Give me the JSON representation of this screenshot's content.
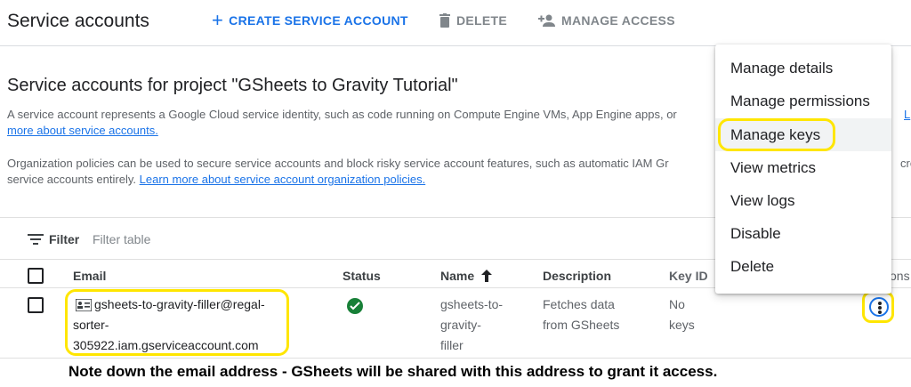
{
  "header": {
    "title": "Service accounts",
    "create_label": "CREATE SERVICE ACCOUNT",
    "delete_label": "DELETE",
    "manage_access_label": "MANAGE ACCESS"
  },
  "section": {
    "title": "Service accounts for project \"GSheets to Gravity Tutorial\"",
    "intro_text": "A service account represents a Google Cloud service identity, such as code running on Compute Engine VMs, App Engine apps, or",
    "intro_link_start": "L",
    "intro_link_rest": "more about service accounts.",
    "org_text": "Organization policies can be used to secure service accounts and block risky service account features, such as automatic IAM Gr",
    "org_text_tail": "cre",
    "org_text2": "service accounts entirely.",
    "org_link": "Learn more about service account organization policies."
  },
  "filter": {
    "label": "Filter",
    "placeholder": "Filter table"
  },
  "table": {
    "columns": {
      "email": "Email",
      "status": "Status",
      "name": "Name",
      "description": "Description",
      "key_id": "Key ID",
      "actions_partial": "ons"
    },
    "rows": [
      {
        "email_line1": "gsheets-to-gravity-filler@regal-",
        "email_line2": "sorter-",
        "email_line3": "305922.iam.gserviceaccount.com",
        "status": "enabled",
        "name_line1": "gsheets-to-",
        "name_line2": "gravity-",
        "name_line3": "filler",
        "desc_line1": "Fetches data",
        "desc_line2": "from GSheets",
        "key_line1": "No",
        "key_line2": "keys"
      }
    ]
  },
  "menu": {
    "items": [
      "Manage details",
      "Manage permissions",
      "Manage keys",
      "View metrics",
      "View logs",
      "Disable",
      "Delete"
    ],
    "highlighted": "Manage keys"
  },
  "note": "Note down the email address - GSheets will be shared with this address to grant it access.",
  "colors": {
    "accent": "#1a73e8",
    "highlight_ring": "#ffe600",
    "status_ok": "#188038"
  }
}
